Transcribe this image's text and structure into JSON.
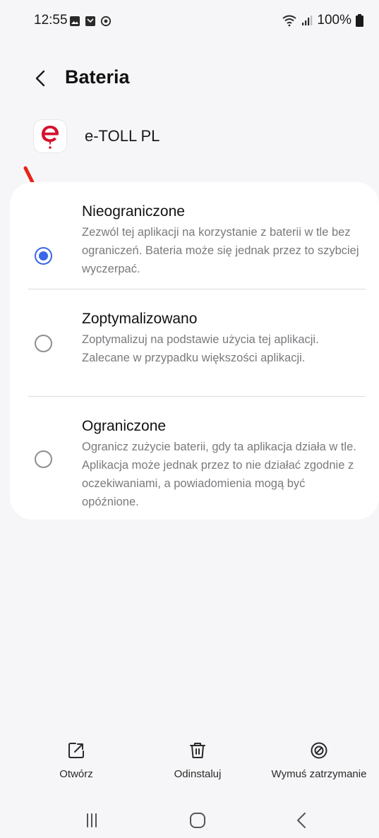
{
  "status_bar": {
    "time": "12:55",
    "battery": "100%",
    "left_icons": [
      "gallery-icon",
      "message-icon",
      "sync-icon"
    ],
    "right_icons": [
      "wifi-icon",
      "signal-icon",
      "battery-icon"
    ]
  },
  "header": {
    "title": "Bateria"
  },
  "app": {
    "name": "e-TOLL PL",
    "icon": "e-toll-logo-icon",
    "icon_color": "#d4112c"
  },
  "options": [
    {
      "title": "Nieograniczone",
      "description": "Zezwól tej aplikacji na korzystanie z baterii w tle bez ograniczeń. Bateria może się jednak przez to szybciej wyczerpać.",
      "selected": true
    },
    {
      "title": "Zoptymalizowano",
      "description": "Zoptymalizuj na podstawie użycia tej aplikacji. Zalecane w przypadku większości aplikacji.",
      "selected": false
    },
    {
      "title": "Ograniczone",
      "description": "Ogranicz zużycie baterii, gdy ta aplikacja działa w tle. Aplikacja może jednak przez to nie działać zgodnie z oczekiwaniami, a powiadomienia mogą być opóźnione.",
      "selected": false
    }
  ],
  "actions": [
    {
      "label": "Otwórz",
      "icon": "open-external-icon"
    },
    {
      "label": "Odinstaluj",
      "icon": "trash-icon"
    },
    {
      "label": "Wymuś zatrzymanie",
      "icon": "force-stop-icon"
    }
  ],
  "nav": {
    "buttons": [
      "recents-icon",
      "home-icon",
      "back-icon"
    ]
  },
  "colors": {
    "accent": "#3b67e6",
    "annotation_arrow": "#e8231a",
    "background": "#f6f6f8",
    "card": "#ffffff"
  }
}
